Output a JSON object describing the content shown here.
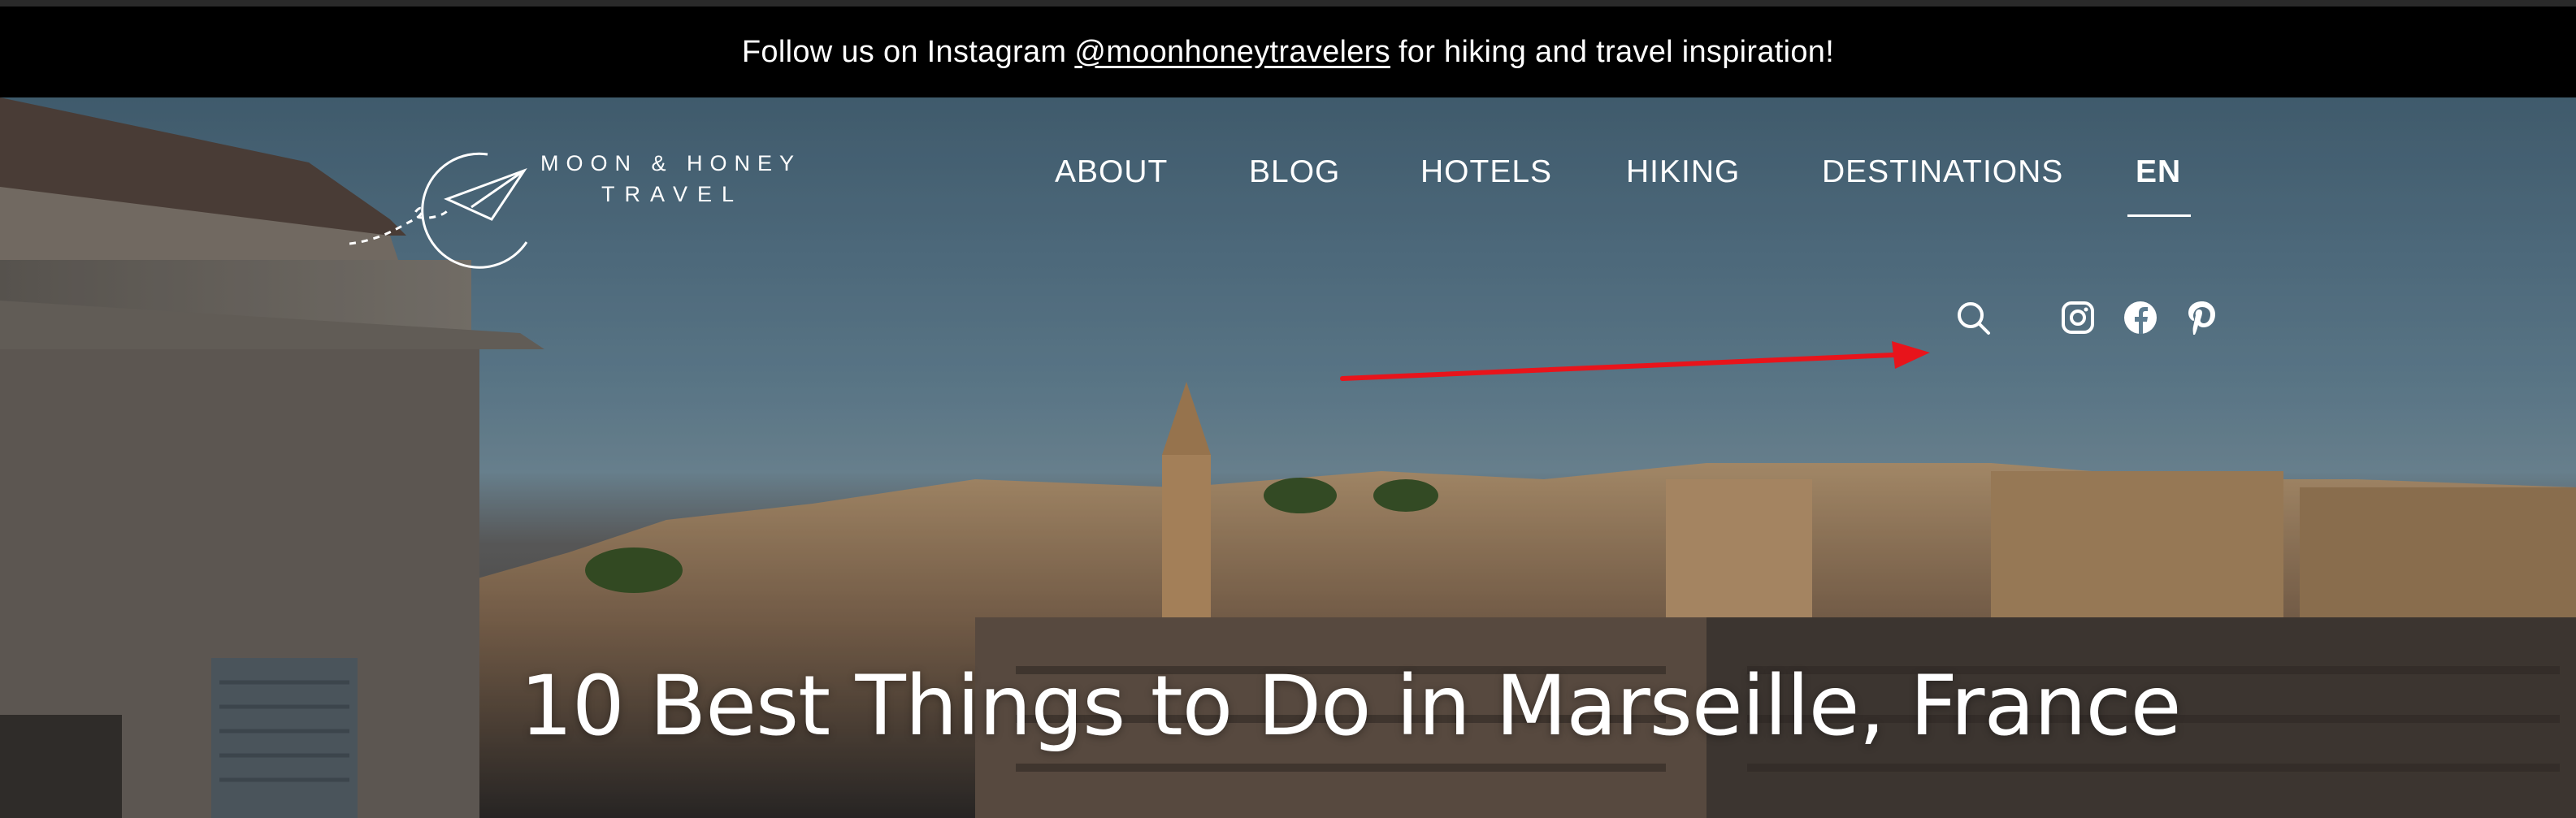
{
  "announcement": {
    "prefix": "Follow us on Instagram",
    "handle": "@moonhoneytravelers",
    "suffix": "for hiking and travel inspiration!"
  },
  "logo": {
    "line1": "MOON & HONEY",
    "line2": "TRAVEL"
  },
  "nav": {
    "items": [
      {
        "label": "ABOUT"
      },
      {
        "label": "BLOG"
      },
      {
        "label": "HOTELS"
      },
      {
        "label": "HIKING"
      },
      {
        "label": "DESTINATIONS"
      }
    ],
    "language": "EN"
  },
  "icons": {
    "search": "search-icon",
    "social": [
      "instagram-icon",
      "facebook-icon",
      "pinterest-icon"
    ]
  },
  "annotation": {
    "arrow_color": "#e8141b"
  },
  "hero": {
    "title": "10 Best Things to Do in Marseille, France"
  },
  "colors": {
    "announcement_bg": "#000000",
    "text": "#ffffff",
    "sky": "#5e8096"
  }
}
